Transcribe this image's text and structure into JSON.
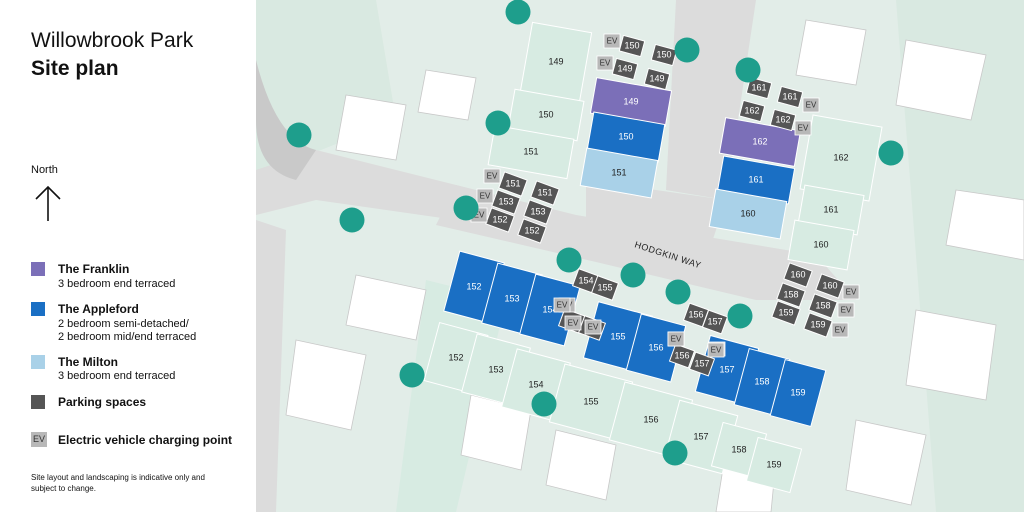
{
  "header": {
    "line1": "Willowbrook Park",
    "line2": "Site plan"
  },
  "north_label": "North",
  "legend": [
    {
      "label": "The Franklin",
      "desc": [
        "3 bedroom end terraced"
      ],
      "color": "#7b6fb8"
    },
    {
      "label": "The Appleford",
      "desc": [
        "2 bedroom semi-detached/",
        "2 bedroom mid/end terraced"
      ],
      "color": "#1a6fc4"
    },
    {
      "label": "The Milton",
      "desc": [
        "3 bedroom end terraced"
      ],
      "color": "#a9d1e8"
    },
    {
      "label": "Parking spaces",
      "desc": [],
      "color": "#555555"
    }
  ],
  "ev_legend": {
    "badge": "EV",
    "label": "Electric vehicle charging point"
  },
  "disclaimer": "Site layout and landscaping is indicative only and subject to change.",
  "map": {
    "road_name": "HODGKIN WAY",
    "colors": {
      "garden": "#d7ebe2",
      "road": "#dcdcdc",
      "existing": "#ffffff",
      "parking": "#555555",
      "ev": "#b8b8b8",
      "tree": "#1e9e8c"
    },
    "houses": [
      {
        "plot": "149",
        "type": "franklin"
      },
      {
        "plot": "150",
        "type": "appleford"
      },
      {
        "plot": "151",
        "type": "milton"
      },
      {
        "plot": "162",
        "type": "franklin"
      },
      {
        "plot": "161",
        "type": "appleford"
      },
      {
        "plot": "160",
        "type": "milton"
      },
      {
        "plot": "152",
        "type": "appleford"
      },
      {
        "plot": "153",
        "type": "appleford"
      },
      {
        "plot": "154",
        "type": "appleford"
      },
      {
        "plot": "155",
        "type": "appleford"
      },
      {
        "plot": "156",
        "type": "appleford"
      },
      {
        "plot": "157",
        "type": "appleford"
      },
      {
        "plot": "158",
        "type": "appleford"
      },
      {
        "plot": "159",
        "type": "appleford"
      }
    ],
    "parking": [
      "150",
      "150",
      "149",
      "149",
      "161",
      "161",
      "162",
      "162",
      "151",
      "151",
      "153",
      "153",
      "152",
      "152",
      "154",
      "155",
      "154",
      "155",
      "156",
      "157",
      "156",
      "157",
      "160",
      "160",
      "158",
      "158",
      "159",
      "159"
    ],
    "gardens": [
      "149",
      "150",
      "151",
      "162",
      "161",
      "160",
      "152",
      "153",
      "154",
      "155",
      "156",
      "157",
      "158",
      "159"
    ],
    "ev_badges": [
      "EV",
      "EV",
      "EV",
      "EV",
      "EV",
      "EV",
      "EV",
      "EV",
      "EV",
      "EV",
      "EV",
      "EV",
      "EV",
      "EV",
      "EV",
      "EV",
      "EV",
      "EV",
      "EV"
    ]
  }
}
